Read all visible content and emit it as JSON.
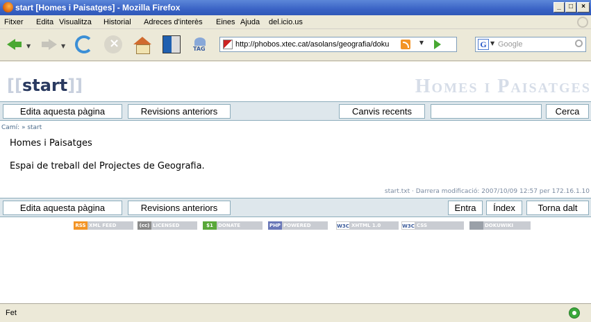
{
  "window": {
    "title": "start [Homes i Paisatges] - Mozilla Firefox"
  },
  "menu": [
    "Fitxer",
    "Edita",
    "Visualitza",
    "Historial",
    "Adreces d'interès",
    "Eines",
    "Ajuda",
    "del.icio.us"
  ],
  "toolbar": {
    "tag_label": "TAG",
    "url": "http://phobos.xtec.cat/asolans/geografia/doku",
    "search_placeholder": "Google"
  },
  "site": {
    "logo_open": "[[",
    "logo_name": "start",
    "logo_close": "]]",
    "title": "Homes i Paisatges"
  },
  "topbar": {
    "edit_label": "Edita aquesta pàgina",
    "revisions_label": "Revisions anteriors",
    "recent_label": "Canvis recents",
    "search_value": "",
    "search_button": "Cerca"
  },
  "breadcrumb": "Camí: » start",
  "content": {
    "heading": "Homes i Paisatges",
    "paragraph": "Espai de treball del Projectes de Geografia."
  },
  "pageinfo": "start.txt · Darrera modificació: 2007/10/09 12:57 per 172.16.1.10",
  "bottombar": {
    "edit_label": "Edita aquesta pàgina",
    "revisions_label": "Revisions anteriors",
    "login_label": "Entra",
    "index_label": "Índex",
    "top_label": "Torna dalt"
  },
  "badges": [
    {
      "left": "RSS",
      "text": "XML FEED"
    },
    {
      "left": "(cc)",
      "text": "LICENSED"
    },
    {
      "left": "$1",
      "text": "DONATE"
    },
    {
      "left": "PHP",
      "text": "POWERED"
    },
    {
      "left": "W3C",
      "text": "XHTML 1.0"
    },
    {
      "left": "W3C",
      "text": "CSS"
    },
    {
      "left": "",
      "text": "DOKUWIKI"
    }
  ],
  "status": {
    "text": "Fet"
  }
}
